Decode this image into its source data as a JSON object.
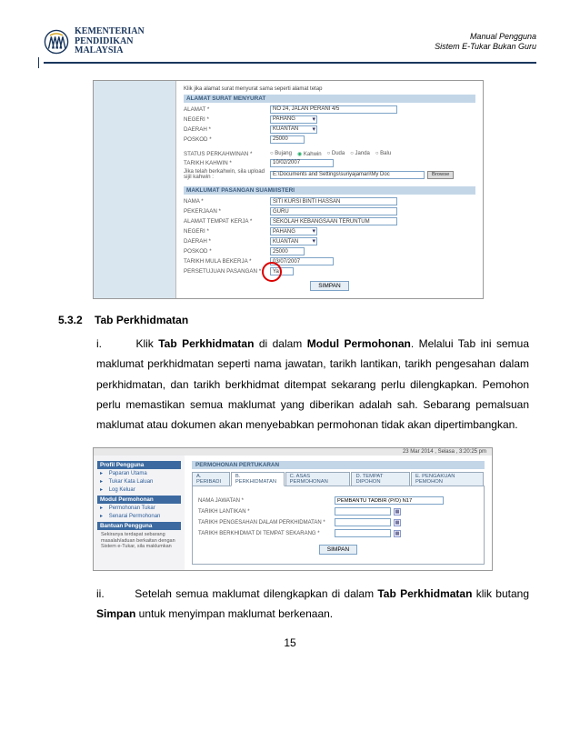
{
  "header": {
    "ministry_line1": "KEMENTERIAN",
    "ministry_line2": "PENDIDIKAN",
    "ministry_line3": "MALAYSIA",
    "doc_line1": "Manual Pengguna",
    "doc_line2": "Sistem E-Tukar Bukan Guru"
  },
  "shot1": {
    "note": "Klik jika alamat surat menyurat sama seperti alamat tetap",
    "sec1": "ALAMAT SURAT MENYURAT",
    "alamat_lbl": "ALAMAT *",
    "alamat": "NO 24, JALAN PERANI 4/5",
    "negeri_lbl": "NEGERI *",
    "negeri": "PAHANG",
    "daerah_lbl": "DAERAH *",
    "daerah": "KUANTAN",
    "poskod_lbl": "POSKOD *",
    "poskod": "25000",
    "status_lbl": "STATUS PERKAHWINAN *",
    "status": {
      "opts": [
        "Bujang",
        "Kahwin",
        "Duda",
        "Janda",
        "Balu"
      ],
      "selected": "Kahwin"
    },
    "tarikhk_lbl": "TARIKH KAHWIN *",
    "tarikhk": "10/02/2007",
    "upload_lbl": "Jika telah berkahwin, sila upload sijil kahwin :",
    "upload_val": "E:\\Documents and Settings\\suriyajamari\\My Doc",
    "browse": "Browse",
    "sec2": "MAKLUMAT PASANGAN SUAMI/ISTERI",
    "nama_lbl": "NAMA *",
    "nama": "SITI KURSI BINTI HASSAN",
    "pekerjaan_lbl": "PEKERJAAN *",
    "pekerjaan": "GURU",
    "tkerja_lbl": "ALAMAT TEMPAT KERJA *",
    "tkerja": "SEKOLAH KEBANGSAAN TERUNTUM",
    "negeri2_lbl": "NEGERI *",
    "negeri2": "PAHANG",
    "daerah2_lbl": "DAERAH *",
    "daerah2": "KUANTAN",
    "poskod2_lbl": "POSKOD *",
    "poskod2": "25000",
    "tmula_lbl": "TARIKH MULA BEKERJA *",
    "tmula": "03/07/2007",
    "persetujuan_lbl": "PERSETUJUAN PASANGAN *",
    "persetujuan": "Ya",
    "simpan": "SIMPAN"
  },
  "section": {
    "num": "5.3.2",
    "title": "Tab Perkhidmatan",
    "p_i_roman": "i.",
    "p_i": "Klik ",
    "p_i_bold1": "Tab Perkhidmatan",
    "p_i_mid": " di dalam ",
    "p_i_bold2": "Modul Permohonan",
    "p_i_tail": ". Melalui Tab ini semua maklumat perkhidmatan seperti nama jawatan, tarikh lantikan, tarikh pengesahan dalam perkhidmatan, dan tarikh berkhidmat ditempat sekarang perlu dilengkapkan. Pemohon perlu memastikan semua maklumat yang diberikan adalah sah. Sebarang pemalsuan maklumat atau dokumen akan menyebabkan permohonan tidak akan dipertimbangkan.",
    "p_ii_roman": "ii.",
    "p_ii_a": "Setelah semua maklumat dilengkapkan di dalam ",
    "p_ii_bold1": "Tab Perkhidmatan",
    "p_ii_b": " klik butang ",
    "p_ii_bold2": "Simpan",
    "p_ii_c": " untuk menyimpan maklumat berkenaan."
  },
  "shot2": {
    "datetime": "23 Mar 2014 , Selasa , 3:20:25 pm",
    "side": {
      "h1": "Profil Pengguna",
      "i1": "Paparan Utama",
      "i2": "Tukar Kata Laluan",
      "i3": "Log Keluar",
      "h2": "Modul Permohonan",
      "i4": "Permohonan Tukar",
      "i5": "Senarai Permohonan",
      "h3": "Bantuan Pengguna",
      "txt": "Sekiranya terdapat sebarang masalah/aduan berkaitan dengan Sistem e-Tukar, sila maklumkan"
    },
    "main": {
      "title": "PERMOHONAN PERTUKARAN",
      "tabs": [
        "A. PERIBADI",
        "B. PERKHIDMATAN",
        "C. ASAS PERMOHONAN",
        "D. TEMPAT DIPOHON",
        "E. PENGAKUAN PEMOHON"
      ],
      "jawatan_lbl": "NAMA JAWATAN *",
      "jawatan": "PEMBANTU TADBIR (P/O) N17",
      "lantikan_lbl": "TARIKH LANTIKAN *",
      "pengesahan_lbl": "TARIKH PENGESAHAN DALAM PERKHIDMATAN *",
      "tempat_lbl": "TARIKH BERKHIDMAT DI TEMPAT SEKARANG *",
      "simpan": "SIMPAN"
    }
  },
  "page_number": "15"
}
